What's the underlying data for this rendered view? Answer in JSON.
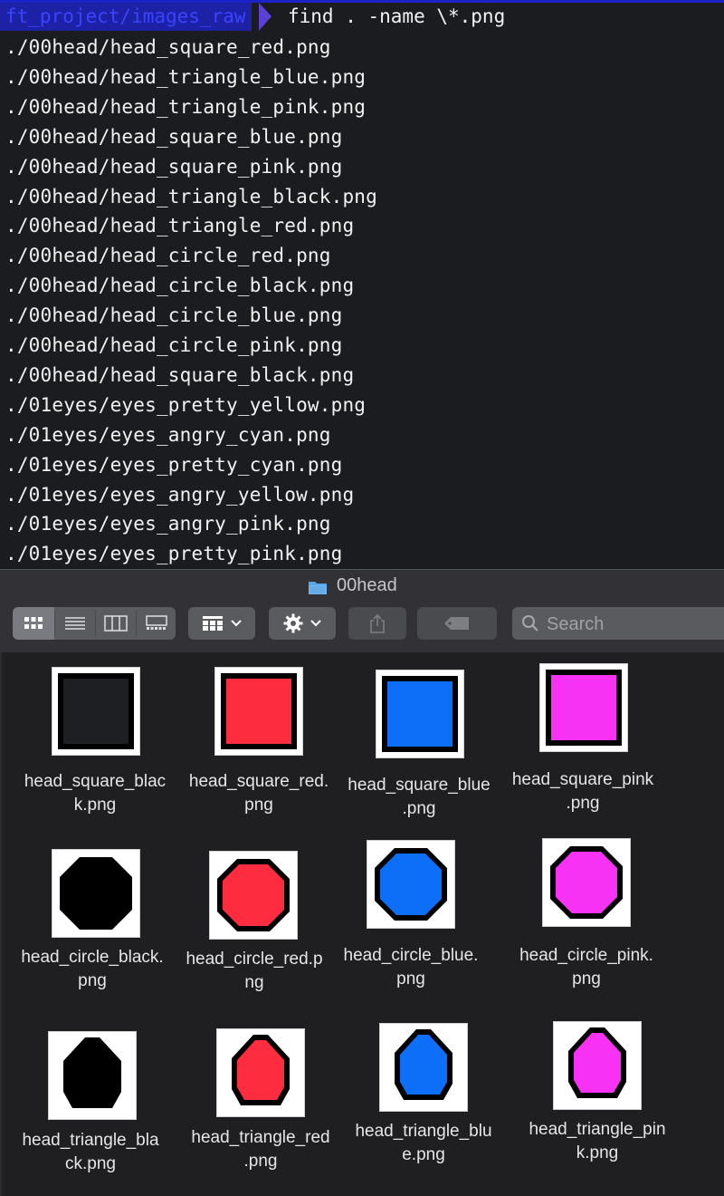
{
  "terminal": {
    "prompt_path": "ft_project/images_raw",
    "command": "find . -name \\*.png",
    "output": [
      "./00head/head_square_red.png",
      "./00head/head_triangle_blue.png",
      "./00head/head_triangle_pink.png",
      "./00head/head_square_blue.png",
      "./00head/head_square_pink.png",
      "./00head/head_triangle_black.png",
      "./00head/head_triangle_red.png",
      "./00head/head_circle_red.png",
      "./00head/head_circle_black.png",
      "./00head/head_circle_blue.png",
      "./00head/head_circle_pink.png",
      "./00head/head_square_black.png",
      "./01eyes/eyes_pretty_yellow.png",
      "./01eyes/eyes_angry_cyan.png",
      "./01eyes/eyes_pretty_cyan.png",
      "./01eyes/eyes_angry_yellow.png",
      "./01eyes/eyes_angry_pink.png",
      "./01eyes/eyes_pretty_pink.png"
    ]
  },
  "finder": {
    "title": "00head",
    "folder_icon": "folder-icon",
    "toolbar": {
      "view_modes": [
        "icon-view-icon",
        "list-view-icon",
        "column-view-icon",
        "gallery-view-icon"
      ],
      "group_icon": "grid-group-icon",
      "action_icon": "gear-icon",
      "share_icon": "share-icon",
      "tag_icon": "tag-icon"
    },
    "search": {
      "placeholder": "Search"
    },
    "files": [
      {
        "label": "head_square_blac\nk.png",
        "shape": "square",
        "color": "#1e1f22"
      },
      {
        "label": "head_square_red.\npng",
        "shape": "square",
        "color": "#fd2d3f"
      },
      {
        "label": "head_square_blue\n.png",
        "shape": "square",
        "color": "#0d6ef8"
      },
      {
        "label": "head_square_pink\n.png",
        "shape": "square",
        "color": "#f832f4"
      },
      {
        "label": "head_circle_black.\npng",
        "shape": "circle",
        "color": "#000000"
      },
      {
        "label": "head_circle_red.p\nng",
        "shape": "circle",
        "color": "#fd2d3f"
      },
      {
        "label": "head_circle_blue.\npng",
        "shape": "circle",
        "color": "#0d6ef8"
      },
      {
        "label": "head_circle_pink.\npng",
        "shape": "circle",
        "color": "#f832f4"
      },
      {
        "label": "head_triangle_bla\nck.png",
        "shape": "triangle",
        "color": "#000000"
      },
      {
        "label": "head_triangle_red\n.png",
        "shape": "triangle",
        "color": "#fd2d3f"
      },
      {
        "label": "head_triangle_blu\ne.png",
        "shape": "triangle",
        "color": "#0d6ef8"
      },
      {
        "label": "head_triangle_pin\nk.png",
        "shape": "triangle",
        "color": "#f832f4"
      }
    ]
  }
}
